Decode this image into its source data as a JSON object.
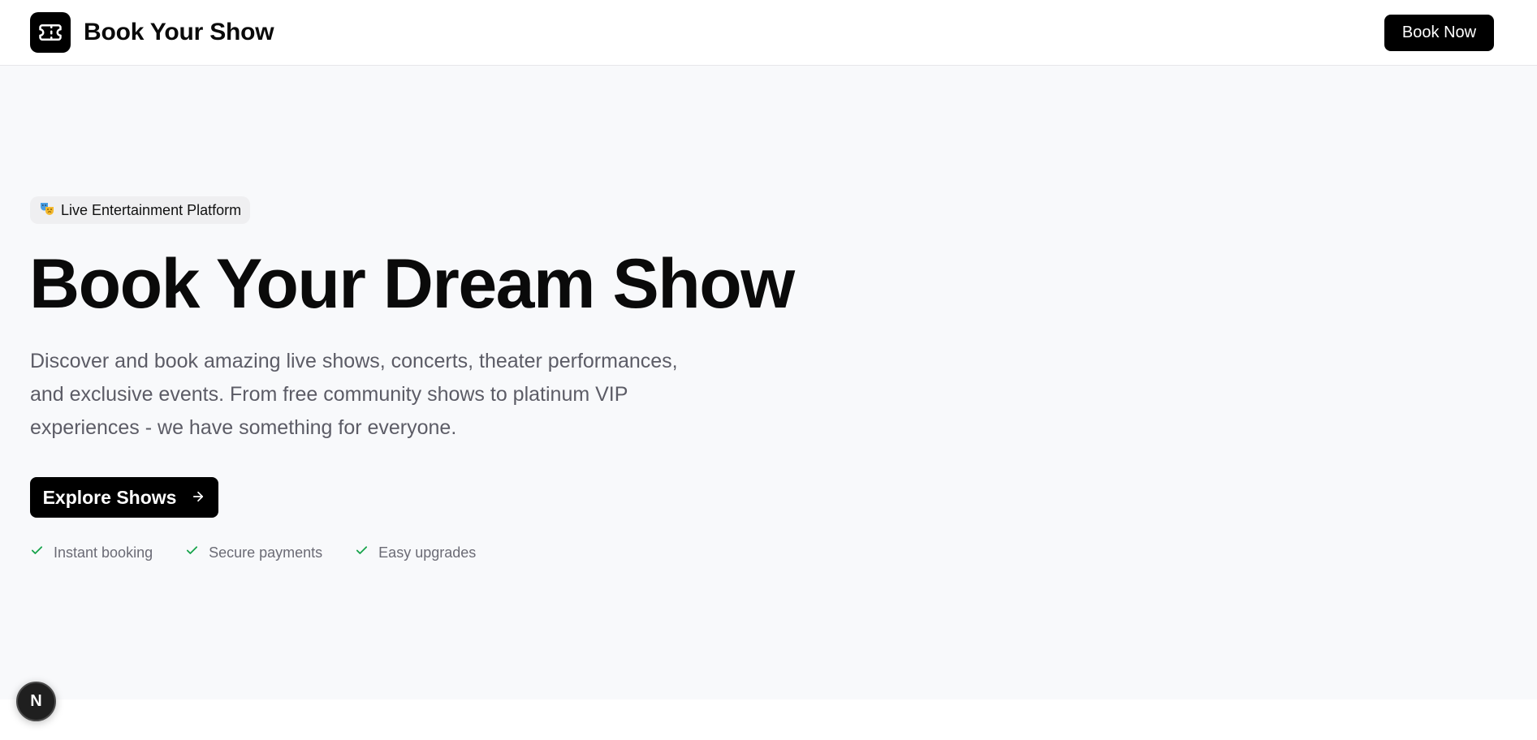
{
  "header": {
    "brand_name": "Book Your Show",
    "logo_icon": "ticket-icon",
    "book_now_label": "Book Now"
  },
  "hero": {
    "badge": {
      "icon": "theater-masks-icon",
      "label": "Live Entertainment Platform"
    },
    "title": "Book Your Dream Show",
    "description": "Discover and book amazing live shows, concerts, theater performances, and exclusive events. From free community shows to platinum VIP experiences - we have something for everyone.",
    "cta_label": "Explore Shows",
    "cta_icon": "arrow-right-icon",
    "features": [
      {
        "icon": "check-icon",
        "label": "Instant booking"
      },
      {
        "icon": "check-icon",
        "label": "Secure payments"
      },
      {
        "icon": "check-icon",
        "label": "Easy upgrades"
      }
    ]
  },
  "dev_indicator": {
    "label": "N"
  },
  "colors": {
    "primary": "#000000",
    "hero_background": "#f8f9fb",
    "check_green": "#16a34a",
    "muted_text": "#5c5c66"
  }
}
